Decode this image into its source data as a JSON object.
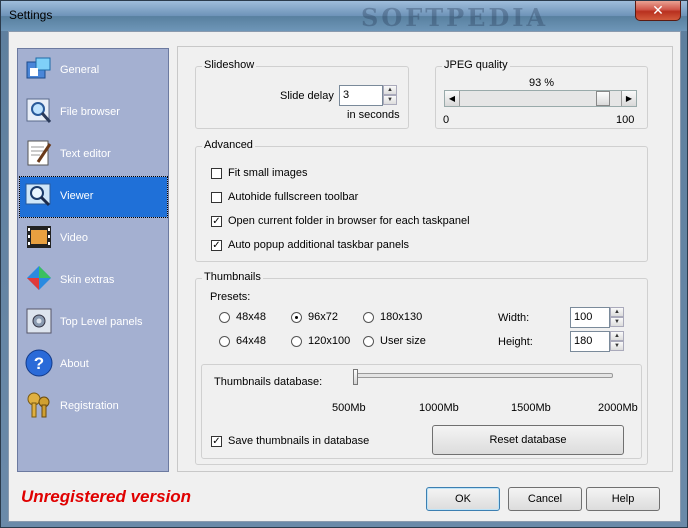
{
  "window": {
    "title": "Settings",
    "watermark": "SOFTPEDIA",
    "close_label": "✕"
  },
  "sidebar": {
    "items": [
      {
        "label": "General",
        "icon": "general-icon",
        "selected": false
      },
      {
        "label": "File browser",
        "icon": "file-browser-icon",
        "selected": false
      },
      {
        "label": "Text editor",
        "icon": "text-editor-icon",
        "selected": false
      },
      {
        "label": "Viewer",
        "icon": "viewer-icon",
        "selected": true
      },
      {
        "label": "Video",
        "icon": "video-icon",
        "selected": false
      },
      {
        "label": "Skin extras",
        "icon": "skin-extras-icon",
        "selected": false
      },
      {
        "label": "Top Level panels",
        "icon": "top-level-panels-icon",
        "selected": false
      },
      {
        "label": "About",
        "icon": "about-icon",
        "selected": false
      },
      {
        "label": "Registration",
        "icon": "registration-icon",
        "selected": false
      }
    ]
  },
  "slideshow": {
    "title": "Slideshow",
    "delay_label": "Slide delay",
    "delay_value": "3",
    "unit_label": "in seconds"
  },
  "jpeg": {
    "title": "JPEG quality",
    "value_label": "93 %",
    "value": 93,
    "min_label": "0",
    "max_label": "100"
  },
  "advanced": {
    "title": "Advanced",
    "options": [
      {
        "label": "Fit small images",
        "checked": false
      },
      {
        "label": "Autohide fullscreen toolbar",
        "checked": false
      },
      {
        "label": "Open current folder in browser for each taskpanel",
        "checked": true
      },
      {
        "label": "Auto popup additional taskbar panels",
        "checked": true
      }
    ]
  },
  "thumbnails": {
    "title": "Thumbnails",
    "presets_label": "Presets:",
    "presets": [
      {
        "label": "48x48",
        "selected": false
      },
      {
        "label": "96x72",
        "selected": true
      },
      {
        "label": "180x130",
        "selected": false
      },
      {
        "label": "64x48",
        "selected": false
      },
      {
        "label": "120x100",
        "selected": false
      },
      {
        "label": "User size",
        "selected": false
      }
    ],
    "width_label": "Width:",
    "width_value": "100",
    "height_label": "Height:",
    "height_value": "180",
    "db_label": "Thumbnails database:",
    "db_ticks": [
      "500Mb",
      "1000Mb",
      "1500Mb",
      "2000Mb"
    ],
    "db_value_fraction": 0.0,
    "save_label": "Save thumbnails in database",
    "save_checked": true,
    "reset_label": "Reset database"
  },
  "footer": {
    "unregistered": "Unregistered version",
    "ok": "OK",
    "cancel": "Cancel",
    "help": "Help"
  }
}
